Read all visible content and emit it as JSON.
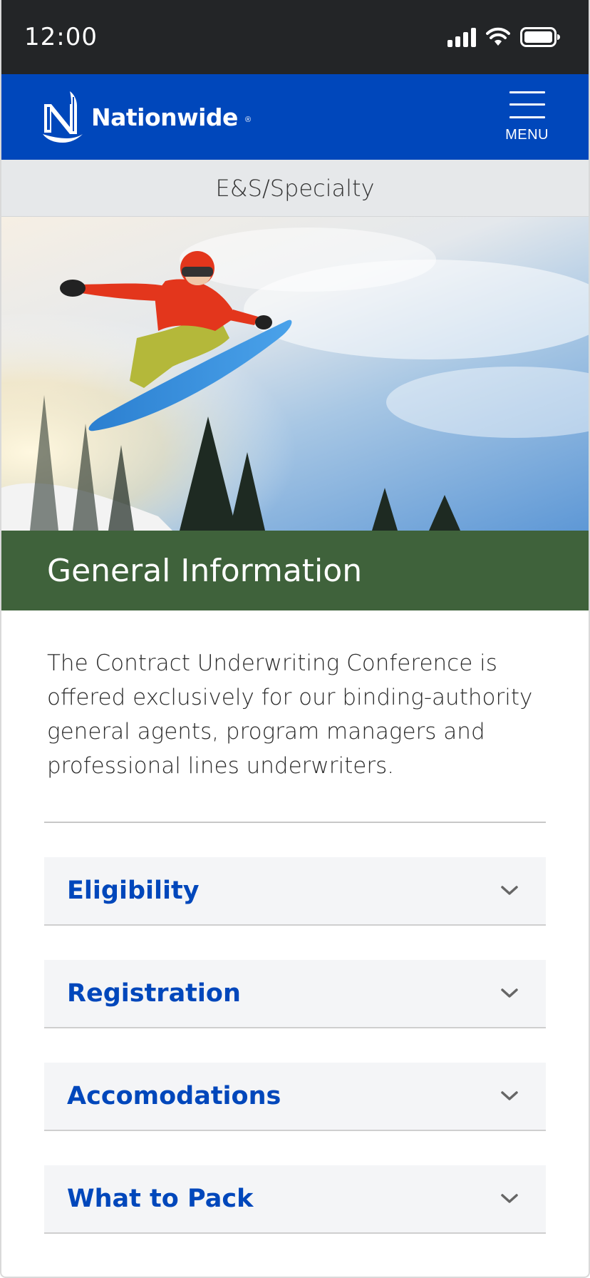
{
  "status_bar": {
    "time": "12:00",
    "icons": [
      "signal-icon",
      "wifi-icon",
      "battery-icon"
    ]
  },
  "header": {
    "brand": "Nationwide",
    "brand_mark": "®",
    "menu_label": "MENU",
    "brand_color": "#0047bb"
  },
  "subnav": {
    "label": "E&S/Specialty"
  },
  "hero": {
    "alt": "hero-image"
  },
  "section": {
    "title": "General Information",
    "band_color": "#3f623b"
  },
  "intro": {
    "text": "The Contract Underwriting Conference is offered exclusively for our binding-authority general agents, program managers and professional lines underwriters."
  },
  "accordion": {
    "items": [
      {
        "label": "Eligibility",
        "icon": "chevron-down-icon"
      },
      {
        "label": "Registration",
        "icon": "chevron-down-icon"
      },
      {
        "label": "Accomodations",
        "icon": "chevron-down-icon"
      },
      {
        "label": "What to Pack",
        "icon": "chevron-down-icon"
      }
    ]
  }
}
